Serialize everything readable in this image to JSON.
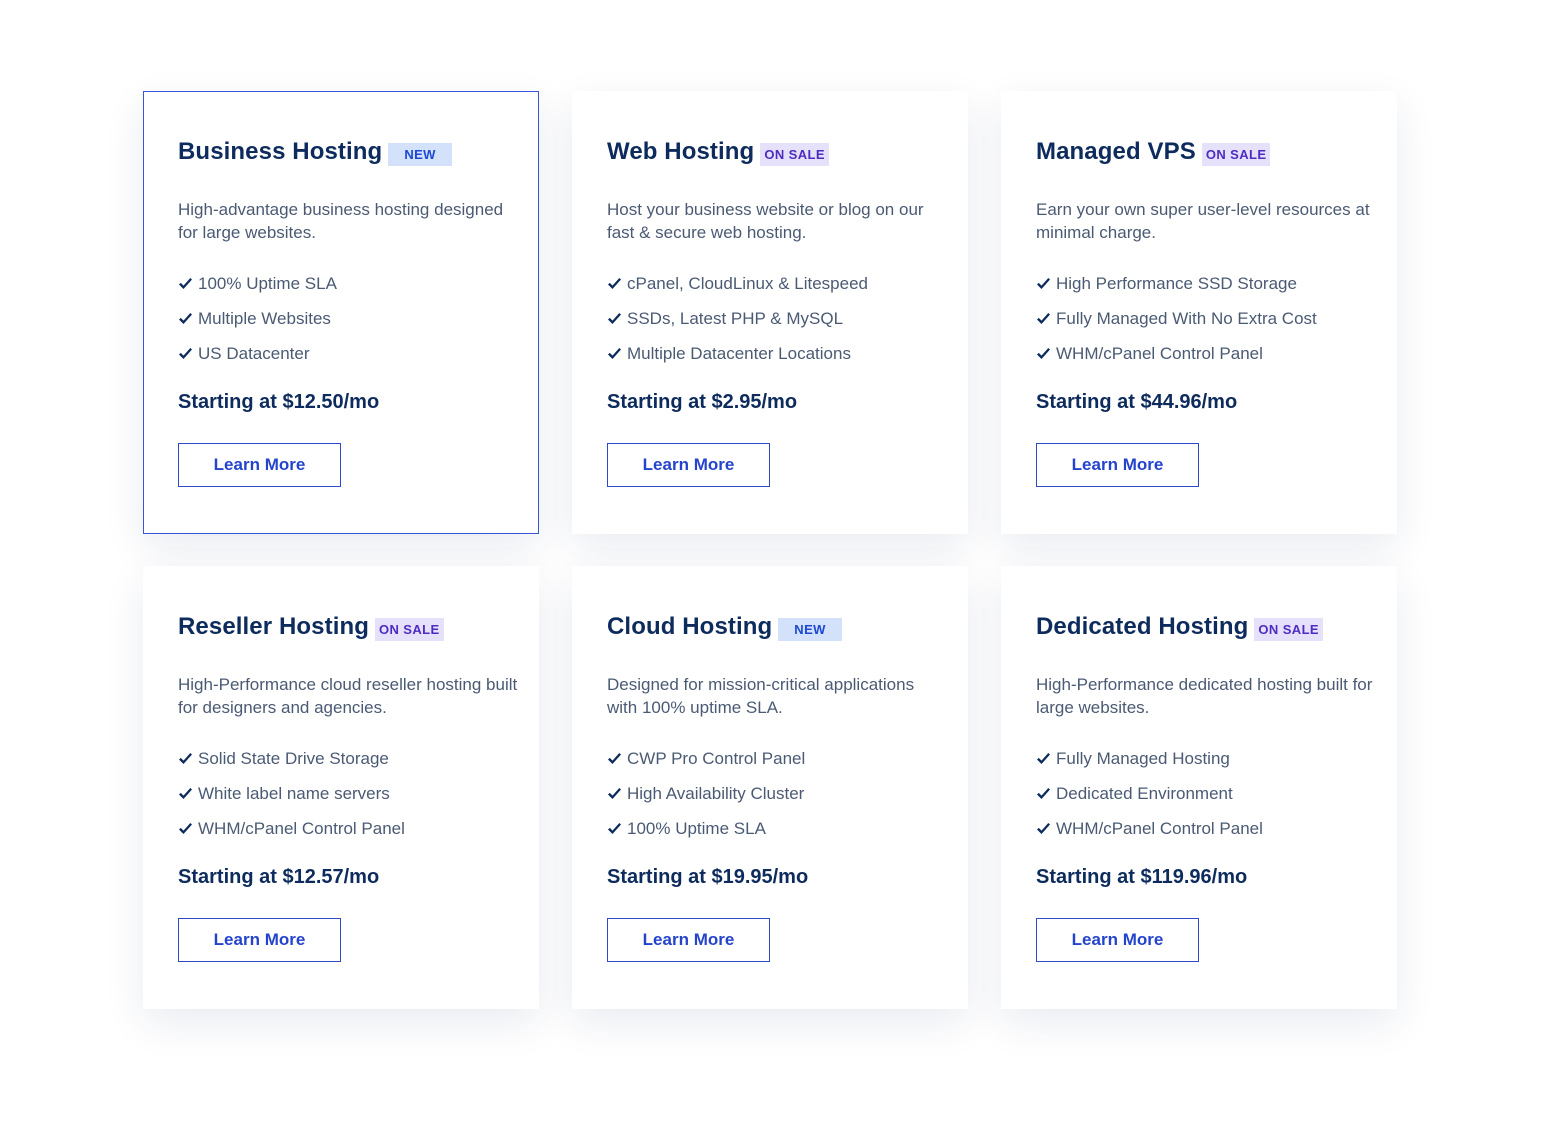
{
  "plans": [
    {
      "title": "Business Hosting",
      "badge": "NEW",
      "badge_type": "new",
      "description": "High-advantage business hosting designed for large websites.",
      "features": [
        "100% Uptime SLA",
        "Multiple Websites",
        "US Datacenter"
      ],
      "price": "Starting at $12.50/mo",
      "button_label": "Learn More"
    },
    {
      "title": "Web Hosting",
      "badge": "ON SALE",
      "badge_type": "sale",
      "description": "Host your business website or blog on our fast & secure web hosting.",
      "features": [
        "cPanel, CloudLinux & Litespeed",
        "SSDs, Latest PHP & MySQL",
        "Multiple Datacenter Locations"
      ],
      "price": "Starting at $2.95/mo",
      "button_label": "Learn More"
    },
    {
      "title": "Managed VPS",
      "badge": "ON SALE",
      "badge_type": "sale",
      "description": "Earn your own super user-level resources at minimal charge.",
      "features": [
        "High Performance SSD Storage",
        "Fully Managed With No Extra Cost",
        "WHM/cPanel Control Panel"
      ],
      "price": "Starting at $44.96/mo",
      "button_label": "Learn More"
    },
    {
      "title": "Reseller Hosting",
      "badge": "ON SALE",
      "badge_type": "sale",
      "description": "High-Performance cloud reseller hosting built for designers and agencies.",
      "features": [
        "Solid State Drive Storage",
        "White label name servers",
        "WHM/cPanel Control Panel"
      ],
      "price": "Starting at $12.57/mo",
      "button_label": "Learn More"
    },
    {
      "title": "Cloud Hosting",
      "badge": "NEW",
      "badge_type": "new",
      "description": "Designed for mission-critical applications with 100% uptime SLA.",
      "features": [
        "CWP Pro Control Panel",
        "High Availability Cluster",
        "100% Uptime SLA"
      ],
      "price": "Starting at $19.95/mo",
      "button_label": "Learn More"
    },
    {
      "title": "Dedicated Hosting",
      "badge": "ON SALE",
      "badge_type": "sale",
      "description": "High-Performance dedicated hosting built for large websites.",
      "features": [
        "Fully Managed Hosting",
        "Dedicated Environment",
        "WHM/cPanel Control Panel"
      ],
      "price": "Starting at $119.96/mo",
      "button_label": "Learn More"
    }
  ],
  "colors": {
    "title": "#0d2b5c",
    "text": "#4b5a73",
    "accent": "#2544cc",
    "active_border": "#3a55d9"
  },
  "icons": {
    "feature_bullet": "check-icon"
  }
}
